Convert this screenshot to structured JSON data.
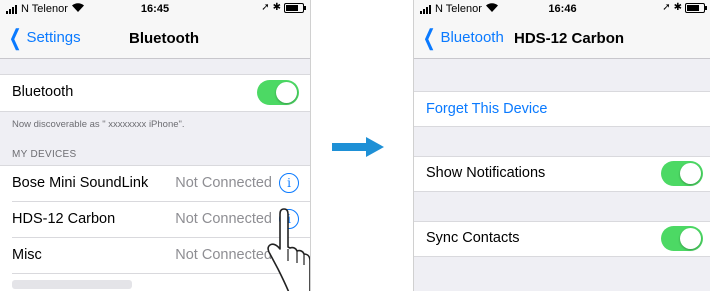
{
  "left": {
    "status_bar": {
      "carrier": "N Telenor",
      "time": "16:45"
    },
    "nav": {
      "back_label": "Settings",
      "title": "Bluetooth"
    },
    "bluetooth_row": {
      "label": "Bluetooth",
      "enabled": true
    },
    "discoverable_text": "Now discoverable as \" xxxxxxxx iPhone\".",
    "section_header": "MY DEVICES",
    "devices": [
      {
        "name": "Bose Mini SoundLink",
        "status": "Not Connected"
      },
      {
        "name": "HDS-12 Carbon",
        "status": "Not Connected"
      },
      {
        "name": "Misc",
        "status": "Not Connected"
      }
    ]
  },
  "arrow": {
    "icon": "right-arrow-icon",
    "color": "#1e90d6"
  },
  "right": {
    "status_bar": {
      "carrier": "N Telenor",
      "time": "16:46"
    },
    "nav": {
      "back_label": "Bluetooth",
      "title": "HDS-12 Carbon"
    },
    "forget_label": "Forget This Device",
    "show_notifications": {
      "label": "Show Notifications",
      "enabled": true
    },
    "sync_contacts": {
      "label": "Sync Contacts",
      "enabled": true
    }
  },
  "colors": {
    "ios_blue": "#0a7aff",
    "toggle_green": "#4cd964",
    "background": "#efeff4"
  }
}
